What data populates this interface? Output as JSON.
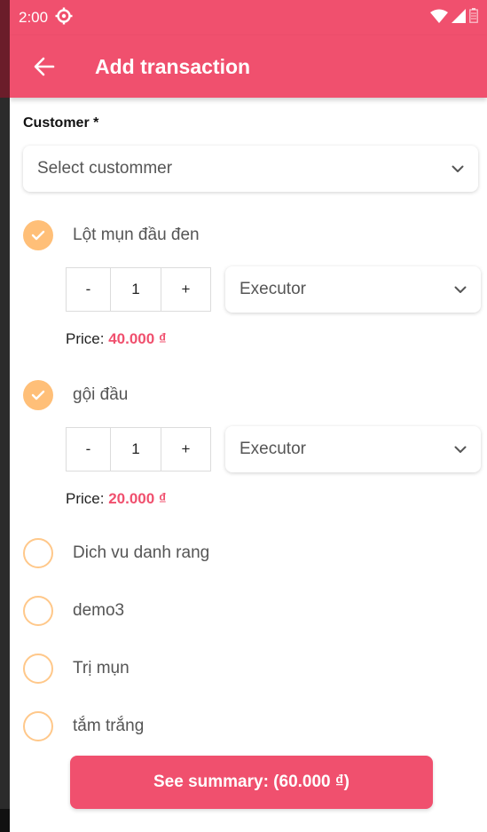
{
  "status_bar": {
    "time": "2:00",
    "icons": [
      "settings-icon",
      "wifi-icon",
      "signal-icon",
      "battery-icon"
    ]
  },
  "app_bar": {
    "title": "Add transaction",
    "back_icon": "arrow-left-icon"
  },
  "customer": {
    "label": "Customer *",
    "placeholder": "Select custommer"
  },
  "services": [
    {
      "name": "Lột mụn đầu đen",
      "checked": true,
      "quantity": "1",
      "executor_placeholder": "Executor",
      "price_label": "Price: ",
      "price": "40.000 ₫"
    },
    {
      "name": "gội đầu",
      "checked": true,
      "quantity": "1",
      "executor_placeholder": "Executor",
      "price_label": "Price: ",
      "price": "20.000 ₫"
    },
    {
      "name": "Dich vu danh rang",
      "checked": false
    },
    {
      "name": "demo3",
      "checked": false
    },
    {
      "name": "Trị mụn",
      "checked": false
    },
    {
      "name": "tắm trắng",
      "checked": false
    }
  ],
  "stepper": {
    "minus": "-",
    "plus": "+"
  },
  "summary_button": {
    "label": "See summary: (60.000 ₫)"
  },
  "colors": {
    "primary": "#f0506e",
    "check_fill": "#ffbf78",
    "check_outline": "#ffc88a"
  }
}
